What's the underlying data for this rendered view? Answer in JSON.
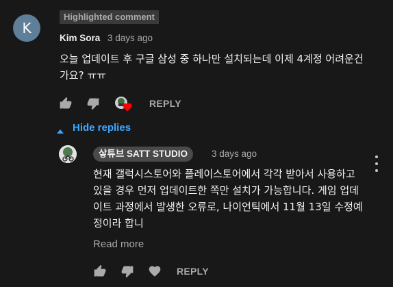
{
  "comment": {
    "avatar_letter": "K",
    "badge": "Highlighted comment",
    "author": "Kim Sora",
    "time": "3 days ago",
    "text": "오늘 업데이트 후 구글 삼성 중 하나만 설치되는데 이제 4계정 어려운건가요? ㅠㅠ",
    "reply_label": "REPLY",
    "heart_color": "#ff0000"
  },
  "replies_toggle": {
    "label": "Hide replies"
  },
  "reply": {
    "author": "샇튜브 SATT STUDIO",
    "time": "3 days ago",
    "text": "현재 갤럭시스토어와 플레이스토어에서 각각 받아서 사용하고 있을 경우 먼저 업데이트한 쪽만 설치가 가능합니다. 게임 업데이트 과정에서 발생한 오류로, 나이언틱에서 11월 13일 수정예정이라 합니",
    "read_more": "Read more",
    "reply_label": "REPLY"
  },
  "colors": {
    "background": "#181818",
    "link_blue": "#3ea6ff",
    "secondary_text": "#aaaaaa"
  }
}
